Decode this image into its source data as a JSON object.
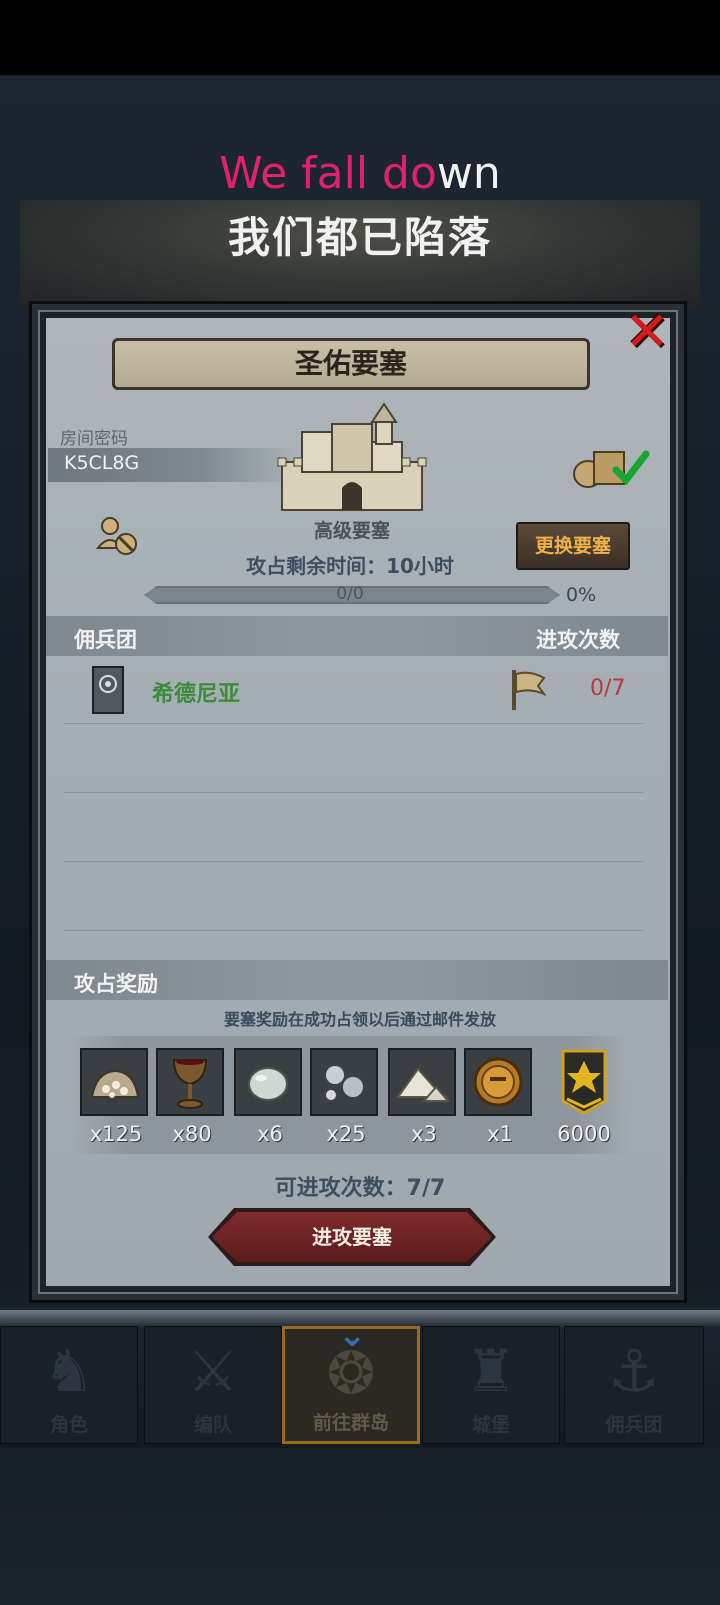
{
  "lyrics": {
    "english_highlighted": "We fall do",
    "english_rest": "wn",
    "chinese": "我们都已陷落"
  },
  "dialog": {
    "title": "圣佑要塞",
    "password_label": "房间密码",
    "password_value": "K5CL8G",
    "fortress_type": "高级要塞",
    "remaining_time": "攻占剩余时间：10小时",
    "swap_button": "更换要塞",
    "progress": {
      "text": "0/0",
      "percent_label": "0%",
      "fraction": 0
    },
    "mercenary_header": "佣兵团",
    "attack_count_header": "进攻次数",
    "mercenary_rows": [
      {
        "name": "希德尼亚",
        "attacks": "0/7"
      }
    ],
    "reward_header": "攻占奖励",
    "reward_note": "要塞奖励在成功占领以后通过邮件发放",
    "rewards": [
      {
        "icon": "bone-pile-icon",
        "qty": "x125"
      },
      {
        "icon": "goblet-icon",
        "qty": "x80"
      },
      {
        "icon": "stone-egg-icon",
        "qty": "x6"
      },
      {
        "icon": "silver-orbs-icon",
        "qty": "x25"
      },
      {
        "icon": "powder-pile-icon",
        "qty": "x3"
      },
      {
        "icon": "knight-medal-icon",
        "qty": "x1"
      },
      {
        "icon": "rank-badge-icon",
        "qty": "6000"
      }
    ],
    "remaining_attempts": "可进攻次数：7/7",
    "attack_button": "进攻要塞"
  },
  "nav": {
    "tabs": [
      {
        "label": "角色",
        "icon": "character-icon"
      },
      {
        "label": "编队",
        "icon": "formation-icon"
      },
      {
        "label": "前往群岛",
        "icon": "islands-icon",
        "active": true
      },
      {
        "label": "城堡",
        "icon": "castle-icon"
      },
      {
        "label": "佣兵团",
        "icon": "mercenary-icon"
      }
    ]
  }
}
